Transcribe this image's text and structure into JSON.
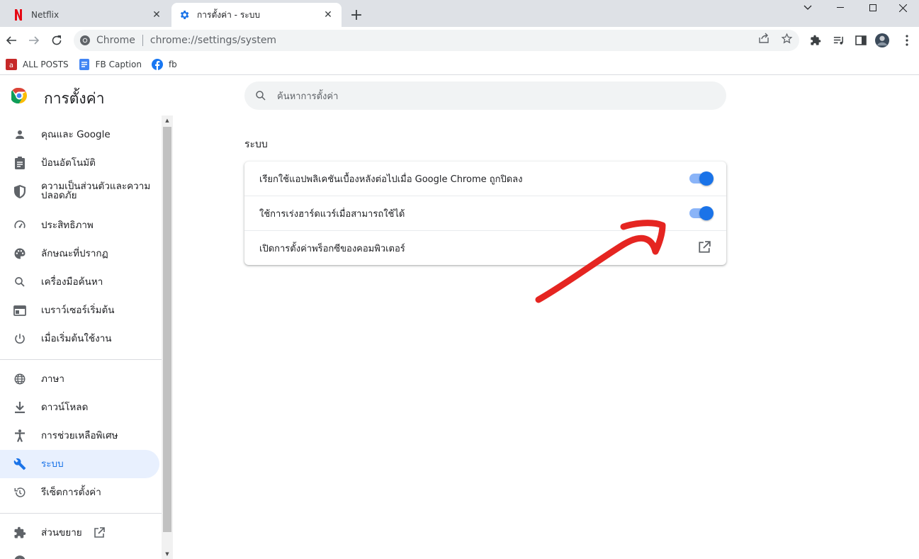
{
  "tabs": [
    {
      "title": "Netflix",
      "active": false,
      "icon": "netflix-icon"
    },
    {
      "title": "การตั้งค่า - ระบบ",
      "active": true,
      "icon": "gear-icon"
    }
  ],
  "omnibox": {
    "site": "Chrome",
    "url": "chrome://settings/system"
  },
  "bookmarks": [
    {
      "label": "ALL POSTS",
      "icon": "blog-icon"
    },
    {
      "label": "FB Caption",
      "icon": "document-icon"
    },
    {
      "label": "fb",
      "icon": "facebook-icon"
    }
  ],
  "settings": {
    "title": "การตั้งค่า",
    "search_placeholder": "ค้นหาการตั้งค่า"
  },
  "sidebar": {
    "items": [
      {
        "label": "คุณและ Google",
        "icon": "person-icon"
      },
      {
        "label": "ป้อนอัตโนมัติ",
        "icon": "clipboard-icon"
      },
      {
        "label": "ความเป็นส่วนตัวและความปลอดภัย",
        "icon": "shield-icon"
      },
      {
        "label": "ประสิทธิภาพ",
        "icon": "speedometer-icon"
      },
      {
        "label": "ลักษณะที่ปรากฏ",
        "icon": "palette-icon"
      },
      {
        "label": "เครื่องมือค้นหา",
        "icon": "search-icon"
      },
      {
        "label": "เบราว์เซอร์เริ่มต้น",
        "icon": "browser-icon"
      },
      {
        "label": "เมื่อเริ่มต้นใช้งาน",
        "icon": "power-icon"
      },
      {
        "label": "ภาษา",
        "icon": "globe-icon"
      },
      {
        "label": "ดาวน์โหลด",
        "icon": "download-icon"
      },
      {
        "label": "การช่วยเหลือพิเศษ",
        "icon": "accessibility-icon"
      },
      {
        "label": "ระบบ",
        "icon": "wrench-icon",
        "selected": true
      },
      {
        "label": "รีเซ็ตการตั้งค่า",
        "icon": "reset-icon"
      },
      {
        "label": "ส่วนขยาย",
        "icon": "puzzle-icon"
      }
    ]
  },
  "system": {
    "section_title": "ระบบ",
    "rows": [
      {
        "label": "เรียกใช้แอปพลิเคชันเบื้องหลังต่อไปเมื่อ Google Chrome ถูกปิดลง",
        "control": "toggle",
        "enabled": true
      },
      {
        "label": "ใช้การเร่งฮาร์ดแวร์เมื่อสามารถใช้ได้",
        "control": "toggle",
        "enabled": true
      },
      {
        "label": "เปิดการตั้งค่าพร็อกซีของคอมพิวเตอร์",
        "control": "external-link"
      }
    ]
  },
  "colors": {
    "accent": "#1a73e8",
    "annotation": "#e52521"
  }
}
